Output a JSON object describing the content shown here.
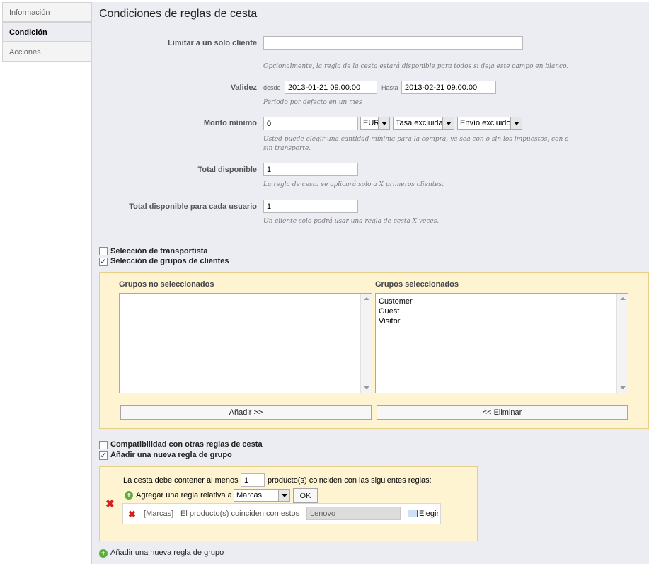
{
  "tabs": [
    {
      "label": "Información"
    },
    {
      "label": "Condición"
    },
    {
      "label": "Acciones"
    }
  ],
  "page_title": "Condiciones de reglas de cesta",
  "form": {
    "limit_customer": {
      "label": "Limitar a un solo cliente",
      "value": "",
      "hint": "Opcionalmente, la regla de la cesta estará disponible para todos si deja este campo en blanco."
    },
    "validity": {
      "label": "Validez",
      "from_label": "desde",
      "from_value": "2013-01-21 09:00:00",
      "to_label": "Hasta",
      "to_value": "2013-02-21 09:00:00",
      "hint": "Periodo por defecto en un mes"
    },
    "min_amount": {
      "label": "Monto mínimo",
      "value": "0",
      "currency": "EUR",
      "tax": "Tasa excluida",
      "shipping": "Envío excluido",
      "hint_line1": "Usted puede elegir una cantidad mínima para la compra, ya sea con o sin los impuestos, con o",
      "hint_line2": "sin transporte."
    },
    "total_available": {
      "label": "Total disponible",
      "value": "1",
      "hint": "La regla de cesta se aplicará solo a X primeros clientes."
    },
    "total_per_user": {
      "label": "Total disponible para cada usuario",
      "value": "1",
      "hint": "Un cliente solo podrá usar una regla de cesta X veces."
    }
  },
  "checkboxes": {
    "carrier": {
      "label": "Selección de transportista",
      "checked": false
    },
    "customer_groups": {
      "label": "Selección de grupos de clientes",
      "checked": true,
      "mark": "✓"
    },
    "compatibility": {
      "label": "Compatibilidad con otras reglas de cesta",
      "checked": false
    },
    "product_rule": {
      "label": "Añadir una nueva regla de grupo",
      "checked": true,
      "mark": "✓"
    }
  },
  "groups": {
    "unselected_title": "Grupos no seleccionados",
    "selected_title": "Grupos seleccionados",
    "unselected": [],
    "selected": [
      "Customer",
      "Guest",
      "Visitor"
    ],
    "add_button": "Añadir >>",
    "remove_button": "<< Eliminar"
  },
  "product_rules": {
    "must_contain_prefix": "La cesta debe contener al menos",
    "quantity": "1",
    "must_contain_suffix": "producto(s) coinciden con las siguientes reglas:",
    "add_rule_label": "Agregar una regla relativa a",
    "rule_type": "Marcas",
    "ok_button": "OK",
    "rule": {
      "type_tag": "[Marcas]",
      "text": "El producto(s) coinciden con estos",
      "value": "Lenovo",
      "choose_label": "Elegir"
    },
    "new_group_link": "Añadir una nueva regla de grupo"
  },
  "icons": {
    "remove": "✖",
    "add": "+"
  }
}
